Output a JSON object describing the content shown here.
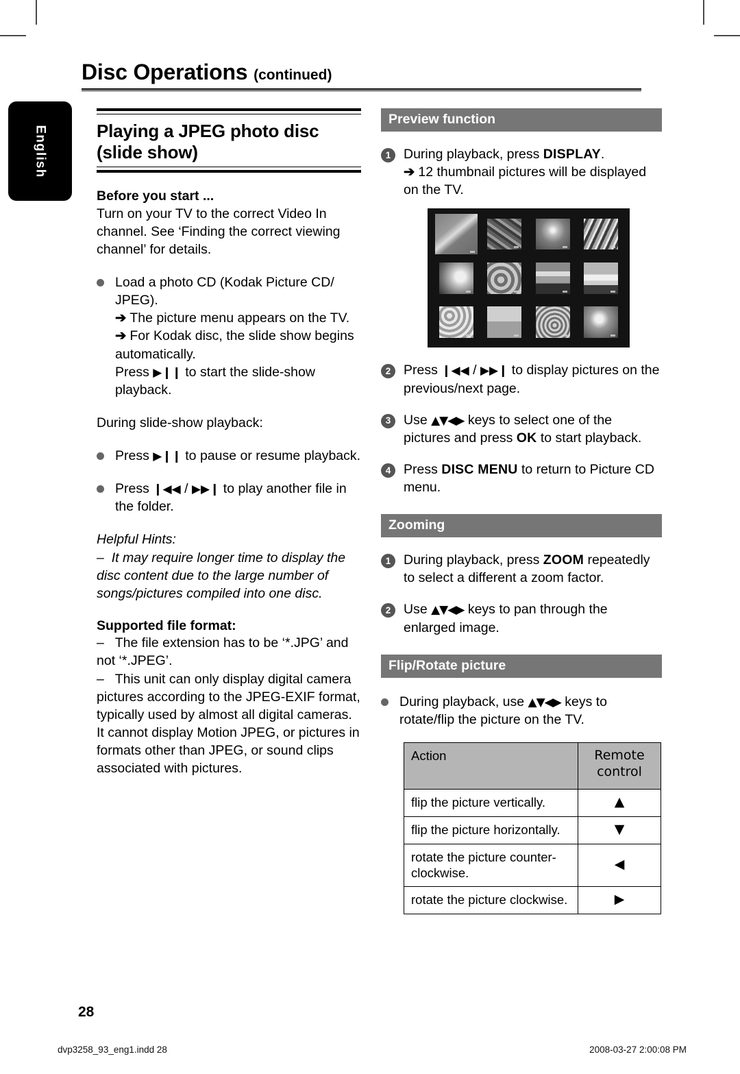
{
  "page": {
    "title": "Disc Operations",
    "title_suffix": "(continued)",
    "number": "28",
    "language_tab": "English"
  },
  "footer": {
    "file": "dvp3258_93_eng1.indd   28",
    "timestamp": "2008-03-27   2:00:08 PM"
  },
  "left_column": {
    "section_title": "Playing a JPEG photo disc (slide show)",
    "before_you_start": {
      "heading": "Before you start ...",
      "text": "Turn on your TV to the correct Video In channel. See ‘Finding the correct viewing channel’ for details."
    },
    "load_bullet": {
      "text": "Load a photo CD (Kodak Picture CD/ JPEG).",
      "arrow1": "The picture menu appears on the TV.",
      "arrow2": "For Kodak disc, the slide show begins automatically.",
      "press_prefix": "Press",
      "press_glyph": "▶❙❙",
      "press_suffix": "to start the slide-show playback."
    },
    "during_label": "During slide-show playback:",
    "pause_bullet": {
      "prefix": "Press",
      "glyph": "▶❙❙",
      "suffix": "to pause or resume playback."
    },
    "skip_bullet": {
      "prefix": "Press",
      "glyph_prev": "❙◀◀",
      "separator": "/",
      "glyph_next": "▶▶❙",
      "suffix": "to play another file in the folder."
    },
    "helpful_hints": {
      "heading": "Helpful Hints:",
      "dash": "–",
      "text": "It may require longer time to display the disc content due to the large number of songs/pictures compiled into one disc."
    },
    "supported": {
      "heading": "Supported file format:",
      "items": [
        "The file extension has to be ‘*.JPG’ and not ‘*.JPEG’.",
        "This unit can only display digital camera pictures according to the JPEG-EXIF format, typically used by almost all digital cameras. It cannot display Motion JPEG, or pictures in formats other than JPEG, or sound clips associated with pictures."
      ]
    }
  },
  "right_column": {
    "preview": {
      "bar": "Preview function",
      "step1": {
        "num": "1",
        "prefix": "During playback, press",
        "keyword": "DISPLAY",
        "suffix": ".",
        "arrow": "12 thumbnail pictures will be displayed on the TV."
      },
      "step2": {
        "num": "2",
        "prefix": "Press",
        "glyph_prev": "❙◀◀",
        "separator": "/",
        "glyph_next": "▶▶❙",
        "suffix": "to display pictures on the previous/next page."
      },
      "step3": {
        "num": "3",
        "prefix": "Use",
        "keys": "▲▼◀▶",
        "mid": "keys to select one of the pictures and press",
        "keyword": "OK",
        "suffix": "to start playback."
      },
      "step4": {
        "num": "4",
        "prefix": "Press",
        "keyword": "DISC MENU",
        "suffix": "to return to Picture CD menu."
      },
      "tv_grid": {
        "alt": "12 thumbnail pictures on TV screen",
        "rows": 3,
        "cols": 4,
        "selected_index": 0
      }
    },
    "zooming": {
      "bar": "Zooming",
      "step1": {
        "num": "1",
        "prefix": "During playback, press",
        "keyword": "ZOOM",
        "suffix": "repeatedly to select a different a zoom factor."
      },
      "step2": {
        "num": "2",
        "prefix": "Use",
        "keys": "▲▼◀▶",
        "suffix": "keys to pan through the enlarged image."
      }
    },
    "flip_rotate": {
      "bar": "Flip/Rotate picture",
      "bullet": {
        "prefix": "During playback, use",
        "keys": "▲▼◀▶",
        "suffix": "keys to rotate/flip the picture on the TV."
      },
      "table": {
        "headers": [
          "Action",
          "Remote control"
        ],
        "rows": [
          {
            "action": "flip the picture vertically.",
            "key": "▲"
          },
          {
            "action": "flip the picture horizontally.",
            "key": "▼"
          },
          {
            "action": "rotate the picture counter-clockwise.",
            "key": "◀"
          },
          {
            "action": "rotate the picture clockwise.",
            "key": "▶"
          }
        ]
      }
    }
  },
  "colors": {
    "section_bar": "#767676",
    "table_header": "#b5b5b5",
    "bullet_dot": "#666666",
    "step_circle": "#555555",
    "tv_background": "#131313"
  }
}
